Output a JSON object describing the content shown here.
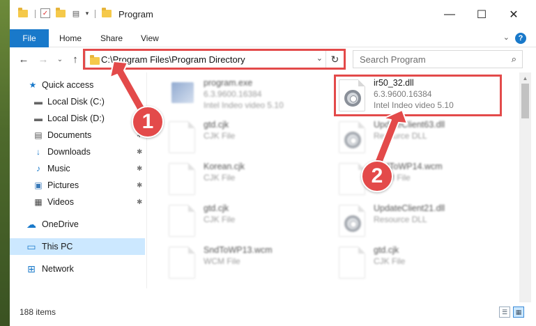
{
  "window": {
    "title": "Program",
    "controls": {
      "minimize": "—",
      "maximize": "☐",
      "close": "✕"
    }
  },
  "ribbon": {
    "tabs": [
      {
        "label": "File",
        "active": true
      },
      {
        "label": "Home"
      },
      {
        "label": "Share"
      },
      {
        "label": "View"
      }
    ],
    "help": "?",
    "expand": "⌄"
  },
  "nav": {
    "back": "←",
    "forward": "→",
    "recent": "⌄",
    "up": "↑",
    "address": "C:\\Program Files\\Program Directory",
    "address_chevron": "⌄",
    "refresh": "↻",
    "search_placeholder": "Search Program",
    "search_icon": "⌕"
  },
  "sidebar": {
    "items": [
      {
        "label": "Quick access",
        "icon": "star-icon",
        "glyph": "★"
      },
      {
        "label": "Local Disk (C:)",
        "icon": "drive-icon",
        "glyph": "▬"
      },
      {
        "label": "Local Disk (D:)",
        "icon": "drive-icon",
        "glyph": "▬"
      },
      {
        "label": "Documents",
        "icon": "documents-icon",
        "glyph": "▤",
        "pinned": true
      },
      {
        "label": "Downloads",
        "icon": "download-icon",
        "glyph": "↓",
        "pinned": true
      },
      {
        "label": "Music",
        "icon": "music-icon",
        "glyph": "♪",
        "pinned": true
      },
      {
        "label": "Pictures",
        "icon": "pictures-icon",
        "glyph": "▣",
        "pinned": true
      },
      {
        "label": "Videos",
        "icon": "videos-icon",
        "glyph": "▦",
        "pinned": true
      },
      {
        "label": "OneDrive",
        "icon": "cloud-icon",
        "glyph": "☁"
      },
      {
        "label": "This PC",
        "icon": "computer-icon",
        "glyph": "▭",
        "active": true
      },
      {
        "label": "Network",
        "icon": "network-icon",
        "glyph": "⊞"
      }
    ],
    "pin_glyph": "📌"
  },
  "files": [
    {
      "name": "program.exe",
      "line1": "6.3.9600.16384",
      "line2": "Intel Indeo video 5.10",
      "icon": "exe-icon",
      "blurred": true
    },
    {
      "name": "ir50_32.dll",
      "line1": "6.3.9600.16384",
      "line2": "Intel Indeo video 5.10",
      "icon": "dll-gear-icon",
      "blurred": false,
      "highlighted": true
    },
    {
      "name": "gtd.cjk",
      "line1": "CJK File",
      "icon": "file-icon",
      "blurred": true
    },
    {
      "name": "UpdateClient63.dll",
      "line1": "Resource DLL",
      "icon": "dll-gear-icon",
      "blurred": true
    },
    {
      "name": "Korean.cjk",
      "line1": "CJK File",
      "icon": "file-icon",
      "blurred": true
    },
    {
      "name": "SndToWP14.wcm",
      "line1": "WCM File",
      "icon": "file-icon",
      "blurred": true
    },
    {
      "name": "gtd.cjk",
      "line1": "CJK File",
      "icon": "file-icon",
      "blurred": true
    },
    {
      "name": "UpdateClient21.dll",
      "line1": "Resource DLL",
      "icon": "dll-gear-icon",
      "blurred": true
    },
    {
      "name": "SndToWP13.wcm",
      "line1": "WCM File",
      "icon": "file-icon",
      "blurred": true
    },
    {
      "name": "gtd.cjk",
      "line1": "CJK File",
      "icon": "file-icon",
      "blurred": true
    }
  ],
  "status": {
    "item_count": "188 items",
    "details_view": "☰",
    "tiles_view": "▦"
  },
  "annotations": [
    {
      "number": "1",
      "color": "#e34a4a"
    },
    {
      "number": "2",
      "color": "#e34a4a"
    }
  ],
  "colors": {
    "accent": "#1979ca",
    "highlight": "#e34a4a",
    "selection": "#cce8ff"
  }
}
